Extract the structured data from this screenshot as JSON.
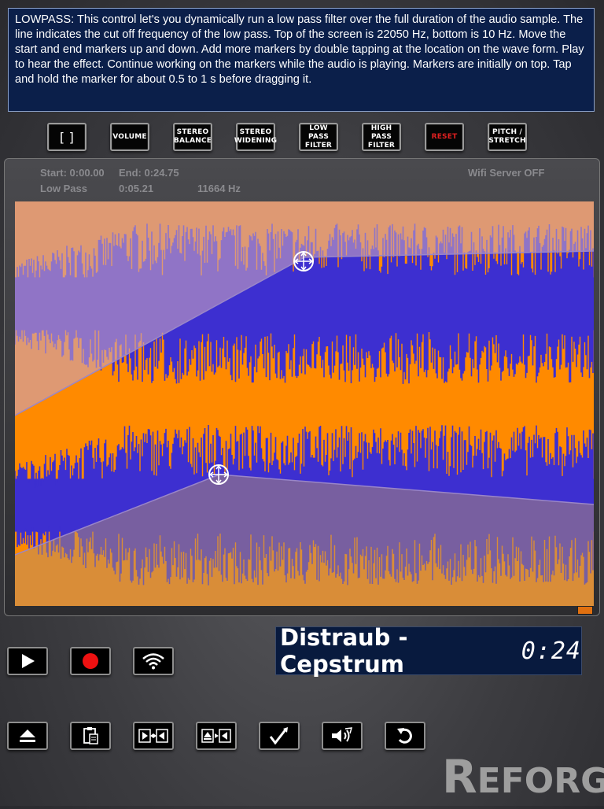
{
  "help_text": "LOWPASS: This control let's you dynamically run a low pass filter over the full duration of the audio sample. The line indicates the cut off frequency of the low pass. Top of the screen is 22050 Hz, bottom is 10 Hz. Move the start and end markers up and down. Add more markers by double tapping at the location on the wave form. Play to hear the effect. Continue working on the markers while the audio is playing. Markers are initially on top. Tap and hold the marker for about 0.5 to 1 s before dragging it.",
  "toolbar": {
    "selection": "[ ]",
    "volume": "Volume",
    "stereo_balance": "Stereo Balance",
    "stereo_widening": "Stereo Widening",
    "low_pass": "Low Pass Filter",
    "high_pass": "High Pass Filter",
    "reset": "Reset",
    "pitch_stretch": "Pitch / Stretch"
  },
  "info": {
    "start": "Start: 0:00.00",
    "end": "End: 0:24.75",
    "wifi_status": "Wifi Server OFF",
    "effect": "Low Pass",
    "marker_time": "0:05.21",
    "frequency": "11664 Hz"
  },
  "track": {
    "name": "Distraub - Cepstrum",
    "time": "0:24"
  },
  "logo": {
    "first": "R",
    "rest": "EFORGE"
  },
  "colors": {
    "waveform_orange": "#ff8a00",
    "waveform_blue": "#3d2fd0",
    "help_bg": "#0b1f4a",
    "record_red": "#ee1111",
    "reset_red": "#e02020"
  },
  "icons": {
    "playback": [
      "play-icon",
      "record-icon",
      "wifi-icon"
    ],
    "tools": [
      "eject-icon",
      "paste-icon",
      "trim-icon",
      "insert-icon",
      "normalize-icon",
      "effect-icon",
      "undo-icon"
    ]
  }
}
